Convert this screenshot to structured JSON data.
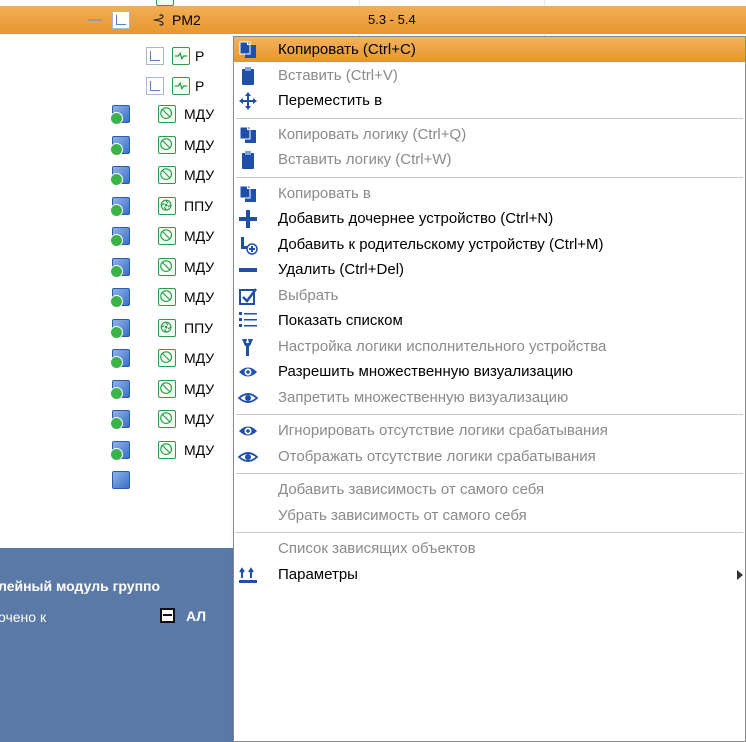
{
  "tree": {
    "selected_row": {
      "label": "PM2",
      "value": "5.3 - 5.4"
    },
    "partial_rows": [
      {
        "label": "P"
      },
      {
        "label": "P"
      }
    ],
    "rows": [
      {
        "label": "МДУ",
        "icon": "valve"
      },
      {
        "label": "МДУ",
        "icon": "valve"
      },
      {
        "label": "МДУ",
        "icon": "valve"
      },
      {
        "label": "ППУ",
        "icon": "fan"
      },
      {
        "label": "МДУ",
        "icon": "valve"
      },
      {
        "label": "МДУ",
        "icon": "valve"
      },
      {
        "label": "МДУ",
        "icon": "valve"
      },
      {
        "label": "ППУ",
        "icon": "fan"
      },
      {
        "label": "МДУ",
        "icon": "valve"
      },
      {
        "label": "МДУ",
        "icon": "valve"
      },
      {
        "label": "МДУ",
        "icon": "valve"
      },
      {
        "label": "МДУ",
        "icon": "valve"
      }
    ]
  },
  "panel": {
    "title": "лейный модуль группо",
    "connected_label": "очено к",
    "connected_value": "АЛ"
  },
  "menu": {
    "items": [
      {
        "label": "Копировать (Ctrl+C)",
        "icon": "copy-icon",
        "enabled": true,
        "highlighted": true
      },
      {
        "label": "Вставить (Ctrl+V)",
        "icon": "paste-icon",
        "enabled": false
      },
      {
        "label": "Переместить в",
        "icon": "move-icon",
        "enabled": true
      },
      {
        "sep": true
      },
      {
        "label": "Копировать логику (Ctrl+Q)",
        "icon": "copy-icon",
        "enabled": false
      },
      {
        "label": "Вставить логику (Ctrl+W)",
        "icon": "paste-icon",
        "enabled": false
      },
      {
        "sep": true
      },
      {
        "label": "Копировать в",
        "icon": "copy-icon",
        "enabled": false
      },
      {
        "label": "Добавить дочернее устройство (Ctrl+N)",
        "icon": "plus-icon",
        "enabled": true
      },
      {
        "label": "Добавить к родительскому устройству (Ctrl+M)",
        "icon": "add-parent-icon",
        "enabled": true
      },
      {
        "label": "Удалить (Ctrl+Del)",
        "icon": "minus-icon",
        "enabled": true
      },
      {
        "label": "Выбрать",
        "icon": "checkbox-icon",
        "enabled": false
      },
      {
        "label": "Показать списком",
        "icon": "list-icon",
        "enabled": true
      },
      {
        "label": "Настройка логики исполнительного устройства",
        "icon": "wrench-icon",
        "enabled": false
      },
      {
        "label": "Разрешить множественную визуализацию",
        "icon": "eye-icon",
        "enabled": true
      },
      {
        "label": "Запретить множественную визуализацию",
        "icon": "eye-outline-icon",
        "enabled": false
      },
      {
        "sep": true
      },
      {
        "label": "Игнорировать отсутствие логики срабатывания",
        "icon": "eye-icon",
        "enabled": false
      },
      {
        "label": "Отображать отсутствие логики срабатывания",
        "icon": "eye-outline-icon",
        "enabled": false
      },
      {
        "sep": true
      },
      {
        "label": "Добавить зависимость от самого себя",
        "icon": "",
        "enabled": false
      },
      {
        "label": "Убрать зависимость от самого себя",
        "icon": "",
        "enabled": false
      },
      {
        "sep": true
      },
      {
        "label": "Список зависящих объектов",
        "icon": "",
        "enabled": false
      },
      {
        "label": "Параметры",
        "icon": "params-icon",
        "enabled": true,
        "submenu": true
      }
    ]
  },
  "colors": {
    "highlight": "#eea443",
    "panel": "#5a79a6",
    "disabled_text": "#8a8a8a",
    "icon_blue": "#1f4fa8"
  }
}
